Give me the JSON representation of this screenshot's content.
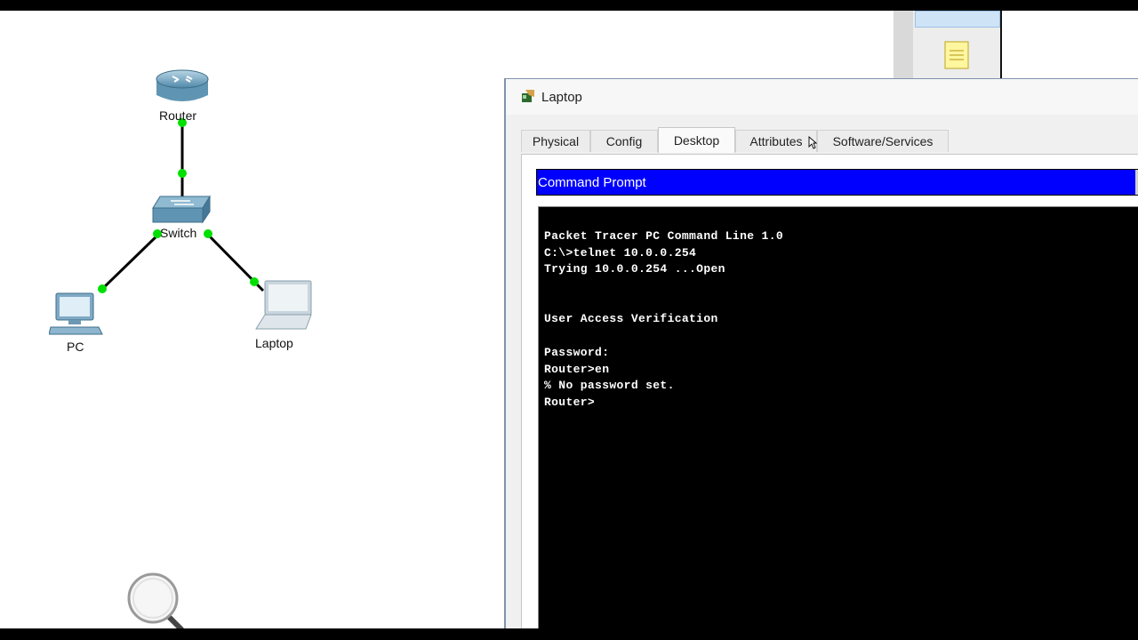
{
  "topology": {
    "devices": [
      {
        "id": "router",
        "label": "Router"
      },
      {
        "id": "switch",
        "label": "Switch"
      },
      {
        "id": "pc",
        "label": "PC"
      },
      {
        "id": "laptop",
        "label": "Laptop"
      }
    ],
    "link_color": "#000000",
    "port_status_color": "#00e000"
  },
  "window": {
    "title": "Laptop",
    "tabs": [
      {
        "label": "Physical",
        "active": false
      },
      {
        "label": "Config",
        "active": false
      },
      {
        "label": "Desktop",
        "active": true
      },
      {
        "label": "Attributes",
        "active": false
      },
      {
        "label": "Software/Services",
        "active": false
      }
    ],
    "command_prompt": {
      "header": "Command Prompt",
      "header_color": "#0000ff",
      "lines": [
        "Packet Tracer PC Command Line 1.0",
        "C:\\>telnet 10.0.0.254",
        "Trying 10.0.0.254 ...Open",
        "",
        "",
        "User Access Verification",
        "",
        "Password:",
        "Router>en",
        "% No password set.",
        "Router>"
      ]
    }
  },
  "icons": [
    "router-icon",
    "switch-icon",
    "pc-icon",
    "laptop-icon",
    "note-icon",
    "zoom-icon",
    "cursor-icon"
  ]
}
